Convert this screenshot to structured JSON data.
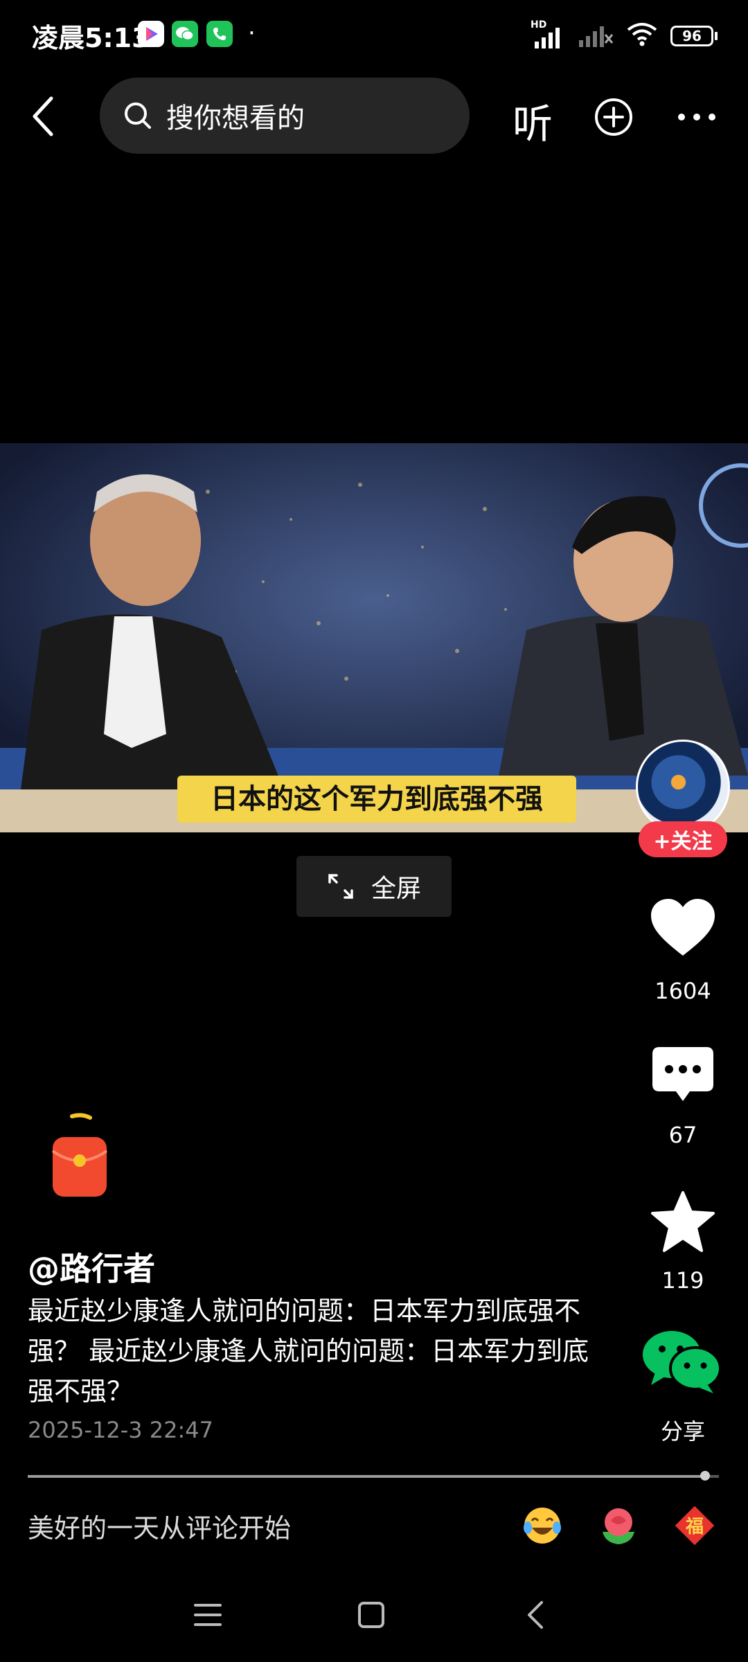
{
  "status_bar": {
    "time": "凌晨5:13",
    "signal_label": "HD",
    "battery": "96"
  },
  "top_bar": {
    "search_placeholder": "搜你想看的",
    "listen_label": "听"
  },
  "video": {
    "subtitle": "日本的这个军力到底强不强",
    "fullscreen_label": "全屏"
  },
  "actions": {
    "follow_label": "+关注",
    "likes": "1604",
    "comments": "67",
    "favorites": "119",
    "share_label": "分享"
  },
  "post": {
    "author": "@路行者",
    "description": "最近赵少康逢人就问的问题：日本军力到底强不强？ 最近赵少康逢人就问的问题：日本军力到底强不强？",
    "timestamp": "2025-12-3 22:47",
    "progress": 0.98
  },
  "comment_bar": {
    "placeholder": "美好的一天从评论开始"
  },
  "icons": {
    "accent_red": "#f33a4a",
    "subtitle_yellow": "#f3d44a",
    "wechat_green": "#07c160"
  }
}
